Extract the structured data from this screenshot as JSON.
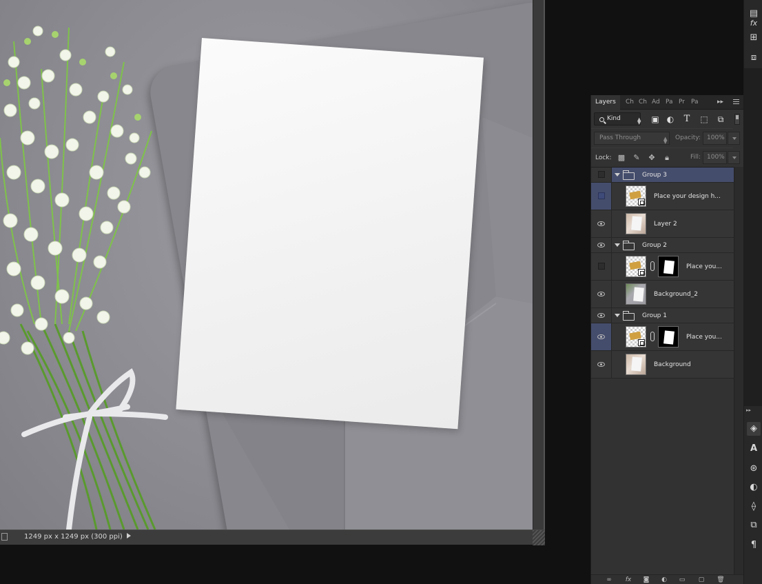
{
  "status_bar": {
    "doc_info": "1249 px x 1249 px (300 ppi)"
  },
  "layers_panel": {
    "tabs": [
      "Layers",
      "Ch",
      "Ch",
      "Ad",
      "Pa",
      "Pr",
      "Pa"
    ],
    "more_glyph": "▸▸",
    "filter": {
      "kind_label": "Kind"
    },
    "blend": {
      "mode": "Pass Through",
      "opacity_label": "Opacity:",
      "opacity_value": "100%"
    },
    "lock": {
      "lock_label": "Lock:",
      "fill_label": "Fill:",
      "fill_value": "100%"
    },
    "layers": [
      {
        "name": "Group 3",
        "type": "group",
        "visible": false,
        "selected": false
      },
      {
        "name": "Place your design h...",
        "type": "smart",
        "visible": false,
        "selected": true
      },
      {
        "name": "Layer 2",
        "type": "photo",
        "visible": true,
        "selected": false
      },
      {
        "name": "Group 2",
        "type": "group",
        "visible": true,
        "selected": false
      },
      {
        "name": "Place you...",
        "type": "smart-mask",
        "visible": false,
        "selected": false
      },
      {
        "name": "Background_2",
        "type": "photo2",
        "visible": true,
        "selected": false
      },
      {
        "name": "Group 1",
        "type": "group",
        "visible": true,
        "selected": false
      },
      {
        "name": "Place you...",
        "type": "smart-mask",
        "visible": true,
        "selected": true
      },
      {
        "name": "Background",
        "type": "photo",
        "visible": true,
        "selected": false
      }
    ]
  },
  "colors": {
    "selected_layer": "#454d6c",
    "panel_bg": "#323232",
    "app_bg": "#111111",
    "canvas_gray": "#8c8c92",
    "card": "#f4f4f4"
  }
}
